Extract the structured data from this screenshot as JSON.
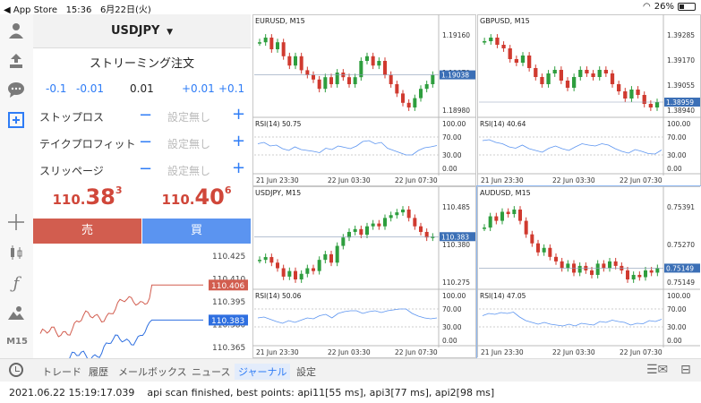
{
  "status_bar": {
    "back_app": "◀ App Store",
    "time": "15:36",
    "date": "6月22日(火)",
    "battery": "26%"
  },
  "rail": {
    "timeframe": "M15"
  },
  "order_panel": {
    "symbol": "USDJPY",
    "title": "ストリーミング注文",
    "lot_steps": [
      "-0.1",
      "-0.01",
      "0.01",
      "+0.01",
      "+0.1"
    ],
    "params": [
      {
        "label": "ストップロス",
        "value": "設定無し"
      },
      {
        "label": "テイクプロフィット",
        "value": "設定無し"
      },
      {
        "label": "スリッページ",
        "value": "設定無し"
      }
    ],
    "sell": {
      "prefix": "110.",
      "big": "38",
      "sup": "3",
      "label": "売"
    },
    "buy": {
      "prefix": "110.",
      "big": "40",
      "sup": "6",
      "label": "買"
    },
    "tick_axis": [
      "110.425",
      "110.410",
      "110.395",
      "110.380",
      "110.365"
    ],
    "ask_tag": "110.406",
    "bid_tag": "110.383",
    "colors": {
      "sell": "#d25d4f",
      "buy": "#5b94f0"
    }
  },
  "charts": [
    {
      "title": "EURUSD, M15",
      "axis": [
        "1.19160",
        "1.19070",
        "1.18980"
      ],
      "price_tag": "1.19038",
      "rsi_label": "RSI(14) 50.75",
      "rsi_axis": [
        "100.00",
        "70.00",
        "30.00",
        "0.00"
      ],
      "times": [
        "21 Jun 23:30",
        "22 Jun 03:30",
        "22 Jun 07:30"
      ],
      "closes": [
        1.1918,
        1.192,
        1.1915,
        1.1918,
        1.1912,
        1.1908,
        1.1912,
        1.1906,
        1.1904,
        1.1902,
        1.1898,
        1.1903,
        1.19,
        1.1905,
        1.1903,
        1.19,
        1.1903,
        1.191,
        1.1912,
        1.1908,
        1.191,
        1.1904,
        1.19,
        1.1896,
        1.1892,
        1.189,
        1.1894,
        1.1898,
        1.19,
        1.1904
      ],
      "rsi": [
        55,
        58,
        50,
        52,
        44,
        40,
        48,
        42,
        40,
        38,
        35,
        45,
        42,
        50,
        47,
        44,
        50,
        60,
        62,
        55,
        58,
        45,
        40,
        35,
        30,
        30,
        40,
        46,
        48,
        51
      ]
    },
    {
      "title": "GBPUSD, M15",
      "axis": [
        "1.39285",
        "1.39170",
        "1.39055",
        "1.38940"
      ],
      "price_tag": "1.38959",
      "rsi_label": "RSI(14) 40.64",
      "rsi_axis": [
        "100.00",
        "70.00",
        "30.00",
        "0.00"
      ],
      "times": [
        "21 Jun 23:30",
        "22 Jun 03:30",
        "22 Jun 07:30"
      ],
      "closes": [
        1.393,
        1.3932,
        1.3928,
        1.3926,
        1.392,
        1.3918,
        1.3922,
        1.3915,
        1.391,
        1.3906,
        1.3912,
        1.3914,
        1.3908,
        1.3904,
        1.391,
        1.3914,
        1.3912,
        1.391,
        1.3914,
        1.3912,
        1.3906,
        1.3902,
        1.3898,
        1.3903,
        1.39,
        1.3895,
        1.3893,
        1.3896
      ],
      "rsi": [
        62,
        64,
        58,
        55,
        48,
        45,
        52,
        44,
        40,
        36,
        45,
        50,
        44,
        40,
        48,
        55,
        52,
        50,
        55,
        52,
        44,
        38,
        34,
        42,
        38,
        33,
        32,
        41
      ]
    },
    {
      "title": "USDJPY, M15",
      "axis": [
        "110.485",
        "110.380",
        "110.275"
      ],
      "price_tag": "110.383",
      "rsi_label": "RSI(14) 50.06",
      "rsi_axis": [
        "100.00",
        "70.00",
        "30.00",
        "0.00"
      ],
      "times": [
        "21 Jun 23:30",
        "22 Jun 03:30",
        "22 Jun 07:30"
      ],
      "closes": [
        110.3,
        110.31,
        110.29,
        110.27,
        110.24,
        110.26,
        110.23,
        110.25,
        110.27,
        110.26,
        110.3,
        110.32,
        110.29,
        110.35,
        110.38,
        110.4,
        110.41,
        110.39,
        110.42,
        110.43,
        110.42,
        110.45,
        110.46,
        110.47,
        110.48,
        110.45,
        110.42,
        110.4,
        110.38,
        110.383
      ],
      "rsi": [
        50,
        52,
        47,
        42,
        38,
        44,
        40,
        45,
        50,
        48,
        55,
        58,
        50,
        60,
        64,
        66,
        66,
        60,
        64,
        66,
        62,
        66,
        68,
        70,
        70,
        60,
        54,
        50,
        48,
        50
      ]
    },
    {
      "title": "AUDUSD, M15",
      "axis": [
        "0.75391",
        "0.75270",
        "0.75149"
      ],
      "price_tag": "0.75149",
      "rsi_label": "RSI(14) 47.05",
      "rsi_axis": [
        "100.00",
        "70.00",
        "30.00",
        "0.00"
      ],
      "times": [
        "21 Jun 23:30",
        "22 Jun 03:30",
        "22 Jun 07:30"
      ],
      "closes": [
        0.7533,
        0.7538,
        0.7536,
        0.754,
        0.7539,
        0.7541,
        0.7536,
        0.753,
        0.7526,
        0.7522,
        0.7524,
        0.752,
        0.7518,
        0.7515,
        0.7517,
        0.7513,
        0.7516,
        0.7514,
        0.7512,
        0.7517,
        0.7515,
        0.7518,
        0.7516,
        0.7514,
        0.751,
        0.7512,
        0.7511,
        0.7514,
        0.7513,
        0.7515
      ],
      "rsi": [
        55,
        60,
        58,
        62,
        60,
        63,
        52,
        44,
        40,
        36,
        40,
        36,
        34,
        32,
        36,
        32,
        38,
        36,
        34,
        42,
        40,
        45,
        42,
        40,
        34,
        38,
        37,
        44,
        42,
        47
      ]
    }
  ],
  "tabbar": {
    "tabs": [
      "トレード",
      "履歴",
      "メールボックス",
      "ニュース",
      "ジャーナル",
      "設定"
    ],
    "active": "ジャーナル"
  },
  "journal": {
    "timestamp": "2021.06.22 15:19:17.039",
    "message": "api scan finished, best points: api11[55 ms], api3[77 ms], api2[98 ms]"
  }
}
